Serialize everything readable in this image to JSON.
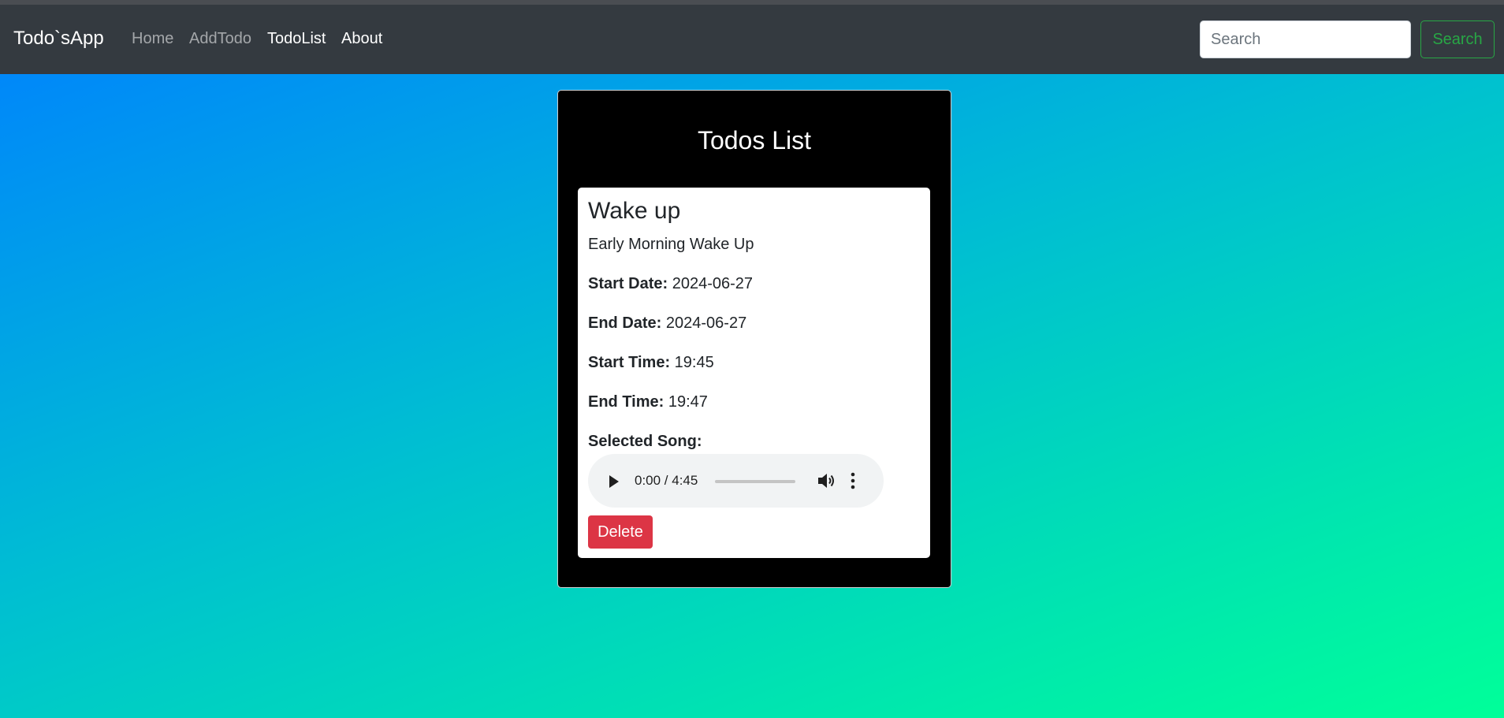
{
  "navbar": {
    "brand": "Todo`sApp",
    "links": [
      {
        "label": "Home"
      },
      {
        "label": "AddTodo"
      },
      {
        "label": "TodoList"
      },
      {
        "label": "About"
      }
    ],
    "search_placeholder": "Search",
    "search_button": "Search"
  },
  "todos": {
    "title": "Todos List",
    "items": [
      {
        "title": "Wake up",
        "description": "Early Morning Wake Up",
        "start_date_label": "Start Date:",
        "start_date": "2024-06-27",
        "end_date_label": "End Date:",
        "end_date": "2024-06-27",
        "start_time_label": "Start Time:",
        "start_time": "19:45",
        "end_time_label": "End Time:",
        "end_time": "19:47",
        "song_label": "Selected Song:",
        "audio_time": "0:00 / 4:45",
        "delete_label": "Delete"
      }
    ]
  },
  "colors": {
    "navbar_bg": "#343a40",
    "search_accent": "#28a745",
    "delete_bg": "#dc3545",
    "gradient_start": "#0080ff",
    "gradient_end": "#00ff99"
  },
  "icons": {
    "play": "play-icon",
    "volume": "volume-icon",
    "more": "more-vertical-icon"
  }
}
